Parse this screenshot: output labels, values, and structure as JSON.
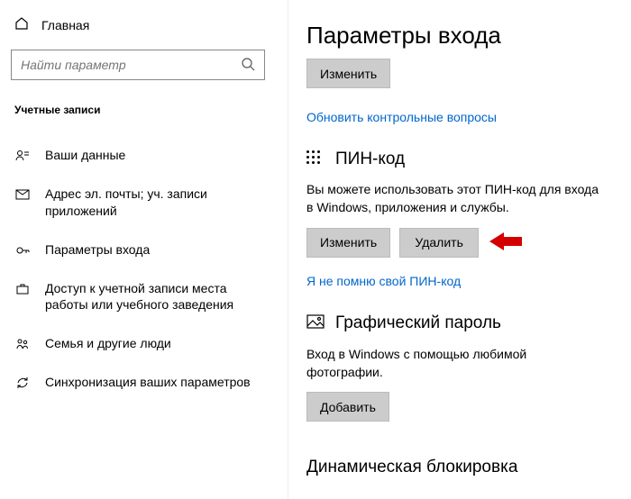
{
  "sidebar": {
    "home_label": "Главная",
    "search_placeholder": "Найти параметр",
    "category": "Учетные записи",
    "items": [
      {
        "label": "Ваши данные"
      },
      {
        "label": "Адрес эл. почты; уч. записи приложений"
      },
      {
        "label": "Параметры входа"
      },
      {
        "label": "Доступ к учетной записи места работы или учебного заведения"
      },
      {
        "label": "Семья и другие люди"
      },
      {
        "label": "Синхронизация ваших параметров"
      }
    ]
  },
  "main": {
    "title": "Параметры входа",
    "top_button": "Изменить",
    "update_questions_link": "Обновить контрольные вопросы",
    "pin": {
      "title": "ПИН-код",
      "desc": "Вы можете использовать этот ПИН-код для входа в Windows, приложения и службы.",
      "change_btn": "Изменить",
      "delete_btn": "Удалить",
      "forgot_link": "Я не помню свой ПИН-код"
    },
    "picture": {
      "title": "Графический пароль",
      "desc": "Вход в Windows с помощью любимой фотографии.",
      "add_btn": "Добавить"
    },
    "dynamic_lock_title": "Динамическая блокировка"
  }
}
